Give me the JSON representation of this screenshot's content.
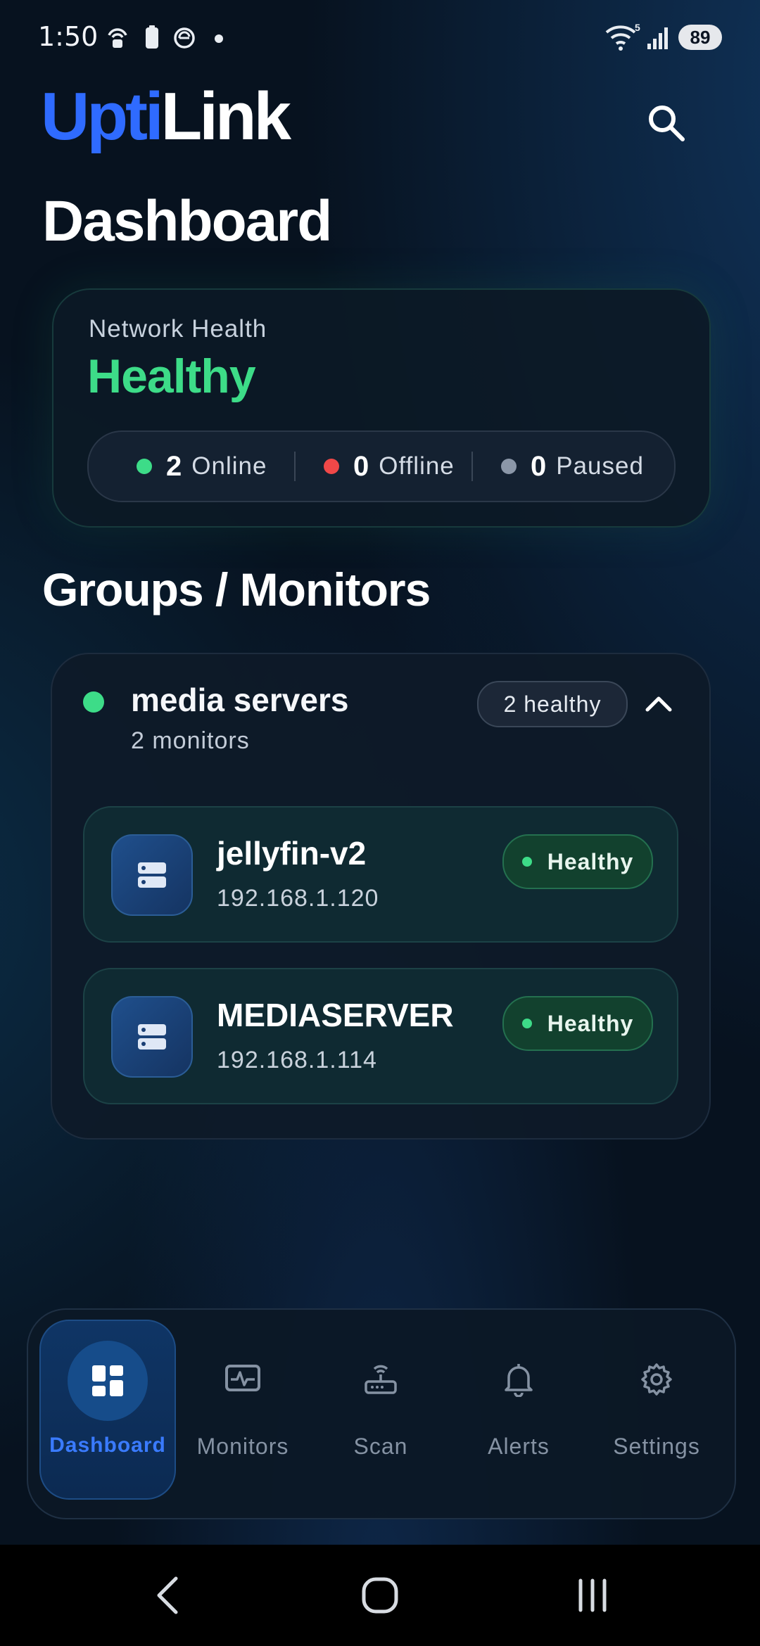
{
  "status_bar": {
    "time": "1:50",
    "battery": "89"
  },
  "header": {
    "brand_part1": "Upti",
    "brand_part2": "Link",
    "page_title": "Dashboard"
  },
  "health": {
    "label": "Network Health",
    "status": "Healthy",
    "online_count": "2",
    "online_label": "Online",
    "offline_count": "0",
    "offline_label": "Offline",
    "paused_count": "0",
    "paused_label": "Paused"
  },
  "section_title": "Groups / Monitors",
  "group": {
    "name": "media servers",
    "count_label": "2 monitors",
    "badge": "2 healthy",
    "monitors": [
      {
        "name": "jellyfin-v2",
        "ip": "192.168.1.120",
        "status": "Healthy"
      },
      {
        "name": "MEDIASERVER",
        "ip": "192.168.1.114",
        "status": "Healthy"
      }
    ]
  },
  "nav": {
    "items": [
      {
        "label": "Dashboard",
        "icon": "dashboard-icon",
        "active": true
      },
      {
        "label": "Monitors",
        "icon": "monitor-pulse-icon"
      },
      {
        "label": "Scan",
        "icon": "router-icon"
      },
      {
        "label": "Alerts",
        "icon": "bell-icon"
      },
      {
        "label": "Settings",
        "icon": "gear-icon"
      }
    ]
  },
  "colors": {
    "accent": "#2f6bff",
    "healthy": "#3ddc88",
    "offline": "#f04848",
    "paused": "#8b97a8"
  }
}
